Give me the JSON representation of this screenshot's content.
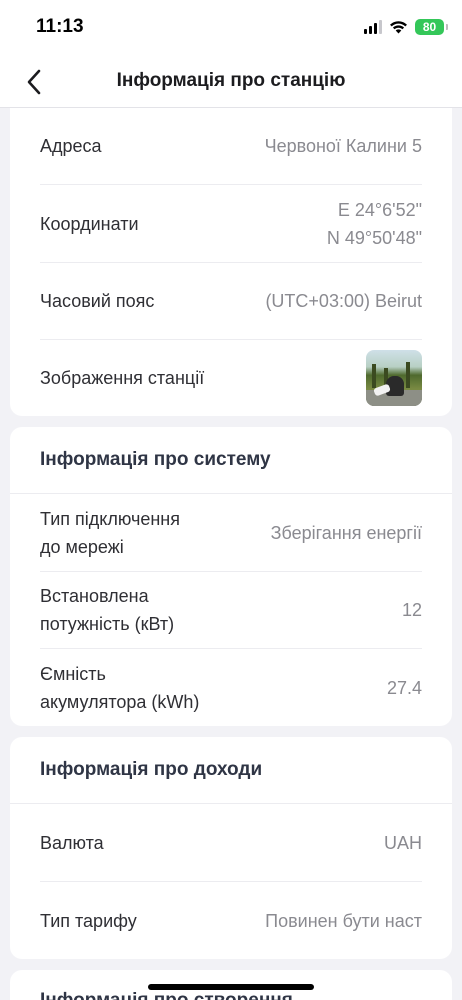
{
  "status_bar": {
    "time": "11:13",
    "battery": "80",
    "icons": [
      "signal-icon",
      "wifi-icon",
      "battery-icon"
    ]
  },
  "nav": {
    "title": "Інформація про станцію",
    "back_icon": "chevron-left-icon"
  },
  "station": {
    "rows": [
      {
        "label": "Адреса",
        "value": "Червоної Калини 5"
      },
      {
        "label": "Координати",
        "value_line1": "E 24°6'52\"",
        "value_line2": "N 49°50'48\""
      },
      {
        "label": "Часовий пояс",
        "value": "(UTC+03:00) Beirut"
      },
      {
        "label": "Зображення станції"
      }
    ]
  },
  "system": {
    "title": "Інформація про систему",
    "rows": [
      {
        "label_line1": "Тип підключення",
        "label_line2": "до мережі",
        "value": "Зберігання енергії"
      },
      {
        "label_line1": "Встановлена",
        "label_line2": "потужність (кВт)",
        "value": "12"
      },
      {
        "label_line1": "Ємність",
        "label_line2": "акумулятора (kWh)",
        "value": "27.4"
      }
    ]
  },
  "income": {
    "title": "Інформація про доходи",
    "rows": [
      {
        "label": "Валюта",
        "value": "UAH"
      },
      {
        "label": "Тип тарифу",
        "value": "Повинен бути наст"
      }
    ]
  },
  "creation": {
    "title": "Інформація про створення"
  },
  "colors": {
    "background": "#f2f2f6",
    "card": "#ffffff",
    "value_text": "#8a8a90",
    "battery": "#34c759"
  }
}
